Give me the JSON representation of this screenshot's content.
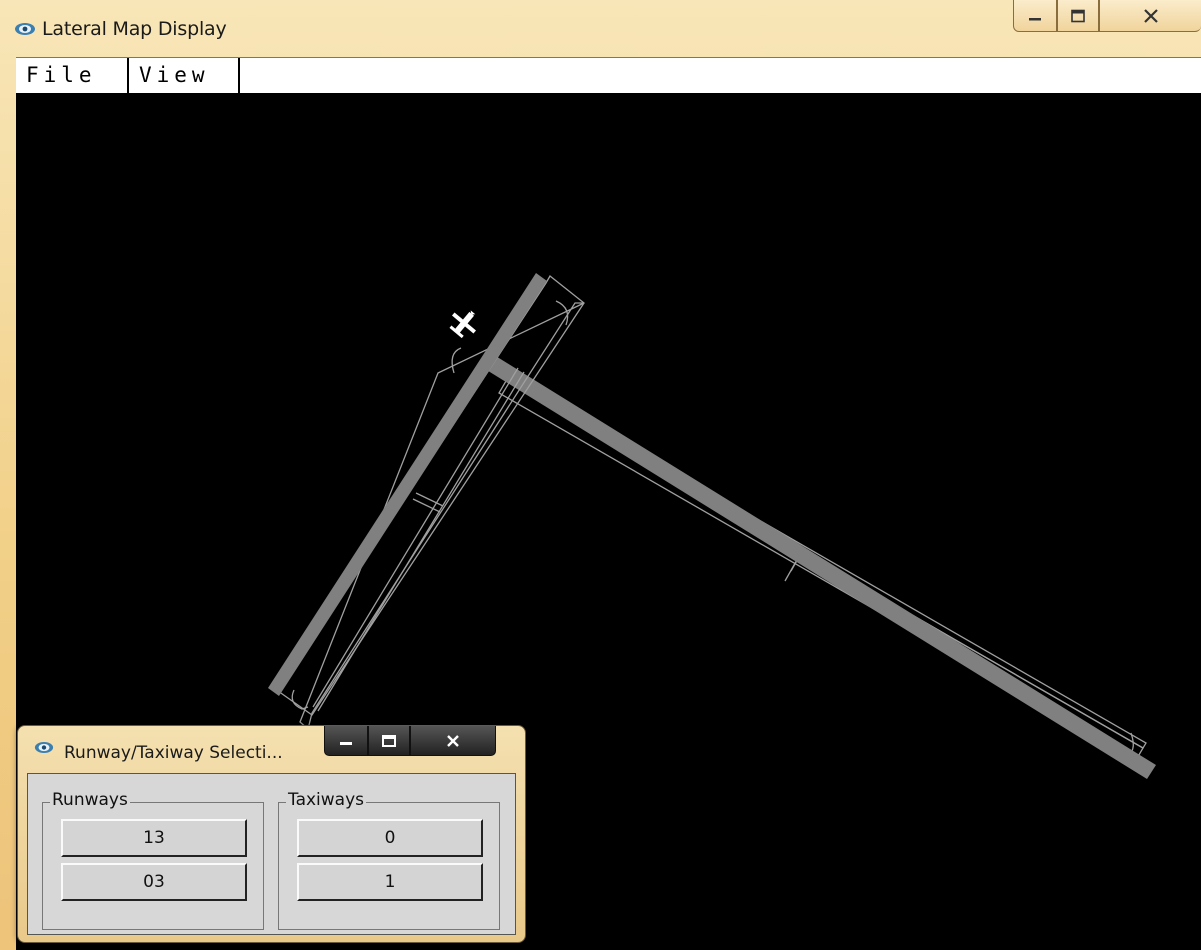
{
  "window": {
    "title": "Lateral Map Display",
    "icon": "app-eye-icon",
    "controls": [
      "minimize-icon",
      "maximize-icon",
      "close-icon"
    ]
  },
  "menu": {
    "file": "File",
    "view": "View"
  },
  "map": {
    "background": "#000000",
    "runway_color": "#808080",
    "outline_color": "#a0a0a0",
    "aircraft_color": "#ffffff",
    "aircraft_icon": "aircraft-icon"
  },
  "dialog": {
    "title": "Runway/Taxiway Selecti...",
    "icon": "app-eye-icon",
    "runways": {
      "label": "Runways",
      "items": [
        "13",
        "03"
      ]
    },
    "taxiways": {
      "label": "Taxiways",
      "items": [
        "0",
        "1"
      ]
    }
  },
  "colors": {
    "frame": "#f1cf86",
    "dialog_body": "#d7d7d7"
  }
}
